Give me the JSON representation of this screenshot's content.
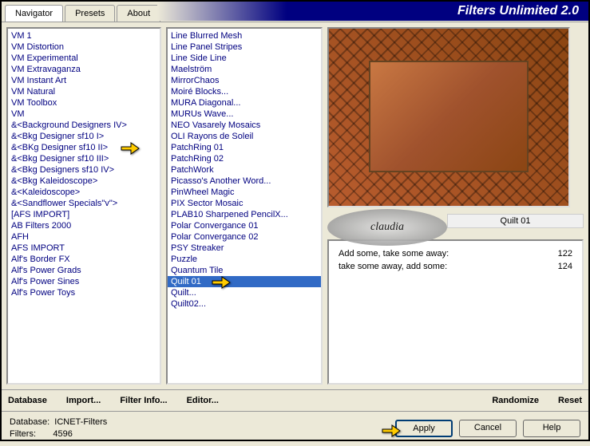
{
  "app_title": "Filters Unlimited 2.0",
  "tabs": [
    "Navigator",
    "Presets",
    "About"
  ],
  "list1": [
    "VM 1",
    "VM Distortion",
    "VM Experimental",
    "VM Extravaganza",
    "VM Instant Art",
    "VM Natural",
    "VM Toolbox",
    "VM",
    "&<Background Designers IV>",
    "&<Bkg Designer sf10 I>",
    "&<BKg Designer sf10 II>",
    "&<Bkg Designer sf10 III>",
    "&<Bkg Designers sf10 IV>",
    "&<Bkg Kaleidoscope>",
    "&<Kaleidoscope>",
    "&<Sandflower Specials\"v\">",
    "[AFS IMPORT]",
    "AB Filters 2000",
    "AFH",
    "AFS IMPORT",
    "Alf's Border FX",
    "Alf's Power Grads",
    "Alf's Power Sines",
    "Alf's Power Toys"
  ],
  "list1_pointer_index": 10,
  "list2": [
    "Line Blurred Mesh",
    "Line Panel Stripes",
    "Line Side Line",
    "Maelström",
    "MirrorChaos",
    "Moiré Blocks...",
    "MURA Diagonal...",
    "MURUs Wave...",
    "NEO Vasarely Mosaics",
    "OLI Rayons de Soleil",
    "PatchRing 01",
    "PatchRing 02",
    "PatchWork",
    "Picasso's Another Word...",
    "PinWheel Magic",
    "PIX Sector Mosaic",
    "PLAB10 Sharpened PencilX...",
    "Polar Convergance 01",
    "Polar Convergance 02",
    "PSY Streaker",
    "Puzzle",
    "Quantum Tile",
    "Quilt 01",
    "Quilt...",
    "Quilt02..."
  ],
  "list2_selected_index": 22,
  "list2_pointer_index": 22,
  "preview": {
    "filter_name": "Quilt 01",
    "watermark": "claudia"
  },
  "sliders": [
    {
      "label": "Add some, take some away:",
      "value": "122"
    },
    {
      "label": "take some away, add some:",
      "value": "124"
    }
  ],
  "button_row": {
    "database": "Database",
    "import": "Import...",
    "filter_info": "Filter Info...",
    "editor": "Editor...",
    "randomize": "Randomize",
    "reset": "Reset"
  },
  "info": {
    "db_label": "Database:",
    "db_value": "ICNET-Filters",
    "filters_label": "Filters:",
    "filters_value": "4596"
  },
  "actions": {
    "apply": "Apply",
    "cancel": "Cancel",
    "help": "Help"
  }
}
